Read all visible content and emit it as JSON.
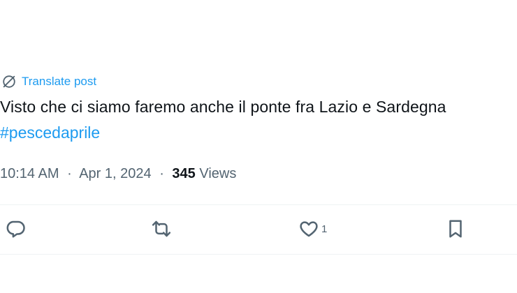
{
  "translate": {
    "label": "Translate post",
    "icon": "globe-slash-icon"
  },
  "tweet": {
    "text": "Visto che ci siamo faremo anche il ponte fra Lazio e Sardegna",
    "hashtag": "#pescedaprile"
  },
  "meta": {
    "time": "10:14 AM",
    "separator": "·",
    "date": "Apr 1, 2024",
    "views_count": "345",
    "views_label": "Views"
  },
  "actions": {
    "reply_icon": "reply-icon",
    "repost_icon": "repost-icon",
    "like_icon": "heart-icon",
    "like_count": "1",
    "bookmark_icon": "bookmark-icon"
  },
  "colors": {
    "accent": "#1d9bf0",
    "text": "#0f1419",
    "secondary": "#536471",
    "divider": "#eff3f4"
  }
}
